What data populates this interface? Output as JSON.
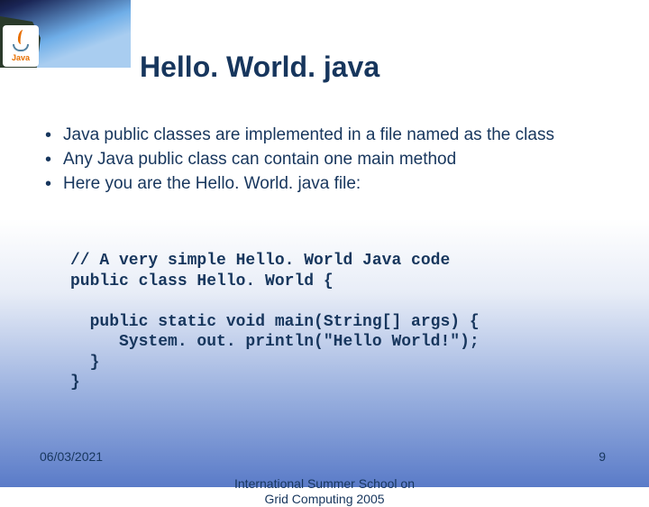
{
  "logo": {
    "text": "Java"
  },
  "title": "Hello. World. java",
  "bullets": [
    "Java public classes are implemented in a file named as the class",
    "Any Java public class can contain one main method",
    "Here you are the Hello. World. java file:"
  ],
  "code": "// A very simple Hello. World Java code\npublic class Hello. World {\n\n  public static void main(String[] args) {\n     System. out. println(\"Hello World!\");\n  }\n}",
  "footer": {
    "date": "06/03/2021",
    "venue_line1": "International Summer School on",
    "venue_line2": "Grid Computing 2005",
    "page": "9"
  }
}
